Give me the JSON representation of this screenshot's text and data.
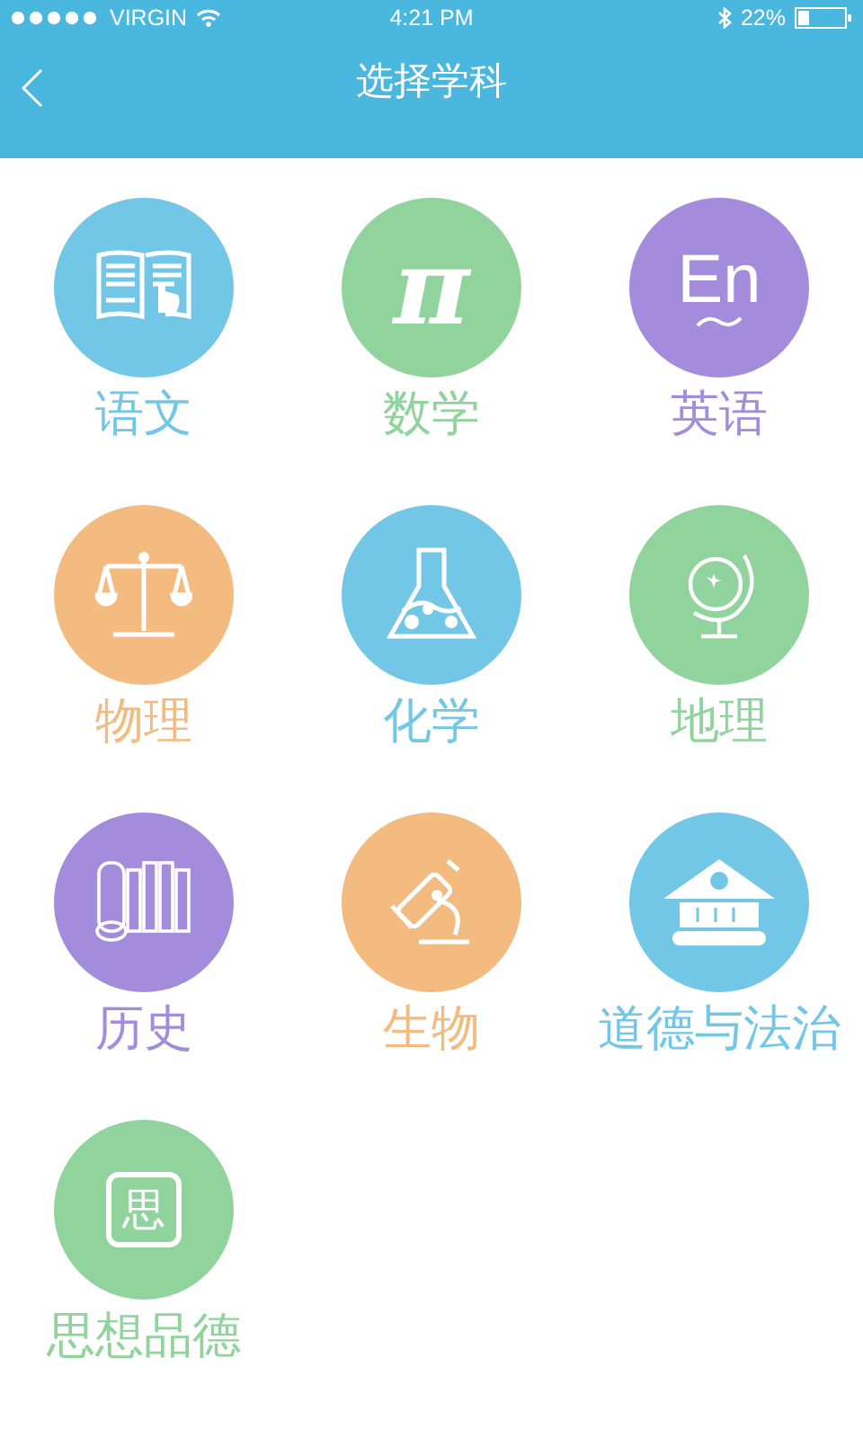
{
  "status_bar": {
    "carrier": "VIRGIN",
    "time": "4:21 PM",
    "battery": "22%"
  },
  "nav": {
    "title": "选择学科"
  },
  "subjects": [
    {
      "label": "语文",
      "color": "#72c6e6",
      "kind": "book"
    },
    {
      "label": "数学",
      "color": "#91d39c",
      "kind": "glyph",
      "icon_text": "π"
    },
    {
      "label": "英语",
      "color": "#a38cdc",
      "kind": "letters",
      "icon_text": "En"
    },
    {
      "label": "物理",
      "color": "#f3bb80",
      "kind": "scale"
    },
    {
      "label": "化学",
      "color": "#72c6e6",
      "kind": "flask"
    },
    {
      "label": "地理",
      "color": "#91d39c",
      "kind": "globe"
    },
    {
      "label": "历史",
      "color": "#a38cdc",
      "kind": "scrolls"
    },
    {
      "label": "生物",
      "color": "#f3bb80",
      "kind": "microscope"
    },
    {
      "label": "道德与法治",
      "color": "#72c6e6",
      "kind": "building"
    },
    {
      "label": "思想品德",
      "color": "#91d39c",
      "kind": "framed",
      "icon_text": "思"
    }
  ]
}
